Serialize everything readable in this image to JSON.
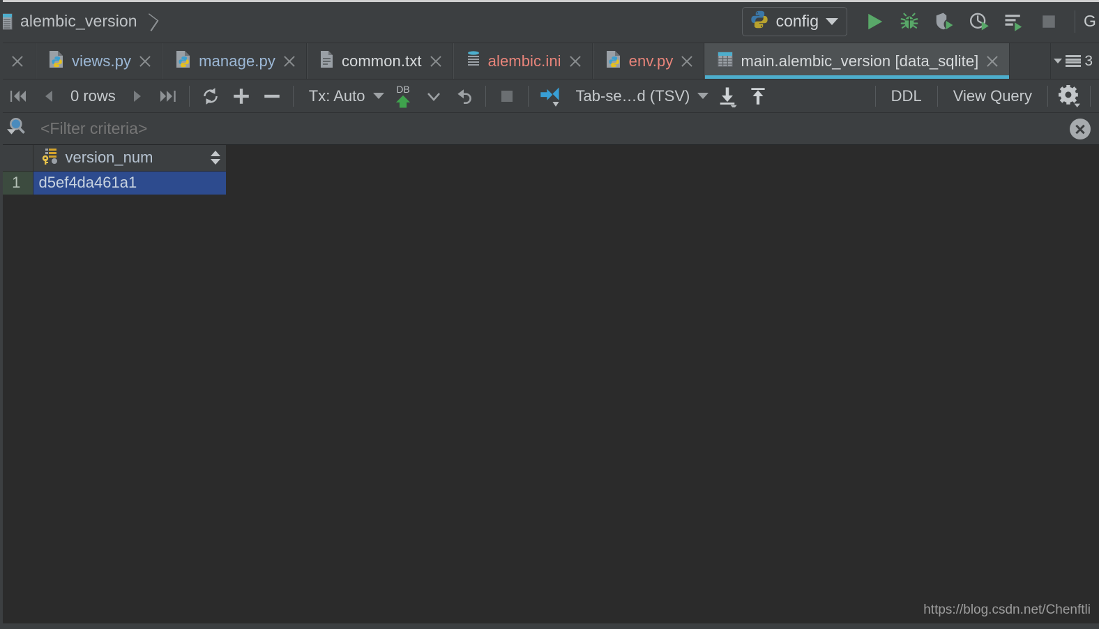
{
  "window": {
    "breadcrumb": "alembic_version",
    "right_overflow_text": "G",
    "watermark": "https://blog.csdn.net/Chenftli"
  },
  "run_config": {
    "name": "config",
    "buttons": [
      {
        "name": "run-button",
        "title": "Run"
      },
      {
        "name": "debug-button",
        "title": "Debug"
      },
      {
        "name": "coverage-button",
        "title": "Run with Coverage"
      },
      {
        "name": "profile-button",
        "title": "Profile"
      },
      {
        "name": "run-tests-button",
        "title": "Run with Console"
      },
      {
        "name": "stop-button",
        "title": "Stop"
      }
    ]
  },
  "editor_tabs": {
    "overflow_count": "3",
    "items": [
      {
        "label": "views.py",
        "icon": "python-file-icon",
        "color": "blue",
        "active": false,
        "has_close": true
      },
      {
        "label": "manage.py",
        "icon": "python-file-icon",
        "color": "blue",
        "active": false,
        "has_close": true
      },
      {
        "label": "common.txt",
        "icon": "text-file-icon",
        "color": "plain",
        "active": false,
        "has_close": true
      },
      {
        "label": "alembic.ini",
        "icon": "ini-file-icon",
        "color": "red",
        "active": false,
        "has_close": true
      },
      {
        "label": "env.py",
        "icon": "python-file-icon",
        "color": "red",
        "active": false,
        "has_close": true
      },
      {
        "label": "main.alembic_version [data_sqlite]",
        "icon": "db-table-icon",
        "color": "plain",
        "active": true,
        "has_close": true
      }
    ]
  },
  "grid_toolbar": {
    "first_page_icon": "first-page-icon",
    "prev_page_icon": "prev-page-icon",
    "row_count": "0 rows",
    "next_page_icon": "next-page-icon",
    "last_page_icon": "last-page-icon",
    "reload_icon": "refresh-icon",
    "add_row_icon": "plus-icon",
    "delete_row_icon": "minus-icon",
    "transaction_label": "Tx: Auto",
    "commit_icon": "db-commit-icon",
    "commit_caret_icon": "chevron-down-icon",
    "rollback_icon": "rollback-icon",
    "cancel_icon": "stop-square-icon",
    "data_extractor_icon": "data-extractor-icon",
    "format_label": "Tab-se…d (TSV)",
    "export_icon": "export-to-file-icon",
    "import_icon": "import-from-file-icon",
    "ddl_label": "DDL",
    "view_query_label": "View Query",
    "settings_icon": "gear-icon"
  },
  "filter": {
    "icon": "search-filter-icon",
    "placeholder": "<Filter criteria>",
    "value": "",
    "clear_icon": "clear-icon"
  },
  "table": {
    "columns": [
      {
        "name": "version_num",
        "icon": "primary-key-icon",
        "sortable": true
      }
    ],
    "rows": [
      {
        "num": "1",
        "values": [
          "d5ef4da461a1"
        ],
        "selected": true
      }
    ]
  },
  "colors": {
    "toolbar_bg": "#3c3f41",
    "grid_bg": "#2b2b2b",
    "active_tab_bg": "#4e5254",
    "active_tab_underline": "#4daecd",
    "selection_blue": "#2d4b8e",
    "rownum_selected": "#3c4b3f",
    "tab_blue_text": "#9cb8d6",
    "tab_red_text": "#e8847a",
    "accent_green": "#43a04a",
    "accent_cyan": "#4daecd"
  }
}
